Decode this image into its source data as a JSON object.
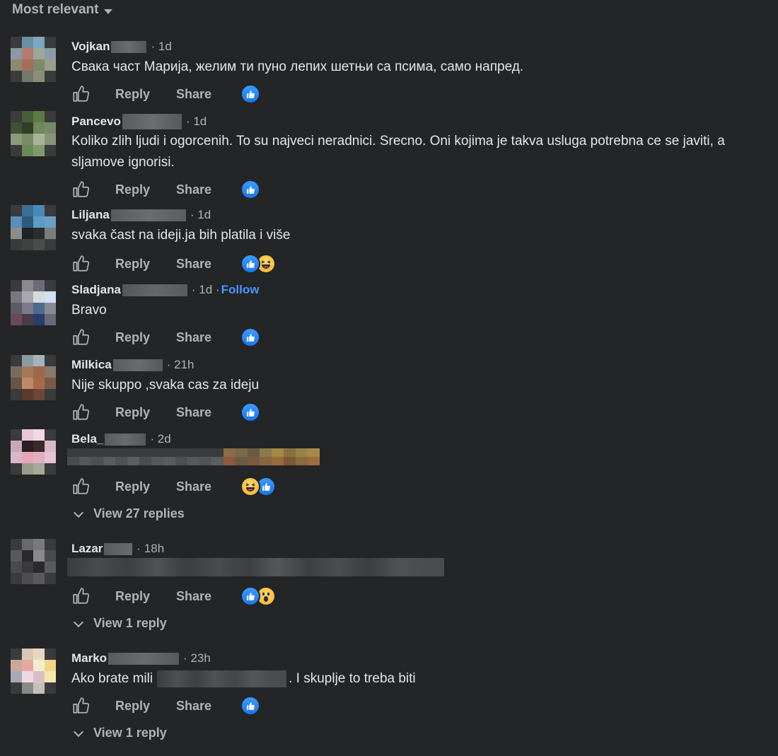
{
  "sort": {
    "label": "Most relevant"
  },
  "actions": {
    "reply": "Reply",
    "share": "Share"
  },
  "comments": [
    {
      "name": "Vojkan",
      "time": "· 1d",
      "text": "Свака част Марија, желим ти пуно лепих шетњи са псима, само напред.",
      "reactions": [
        "like"
      ],
      "replies": ""
    },
    {
      "name": "Pancevo",
      "time": "· 1d",
      "text": "Koliko zlih ljudi i ogorcenih. To su najveci neradnici. Srecno. Oni kojima je takva usluga potrebna ce se javiti, a sljamove ignorisi.",
      "reactions": [
        "like"
      ],
      "replies": ""
    },
    {
      "name": "Liljana",
      "time": "· 1d",
      "text": "svaka čast na ideji.ja bih platila i više",
      "reactions": [
        "like",
        "haha"
      ],
      "replies": ""
    },
    {
      "name": "Sladjana",
      "time": "· 1d ·",
      "follow": "Follow",
      "text": "Bravo",
      "reactions": [
        "like"
      ],
      "replies": ""
    },
    {
      "name": "Milkica",
      "time": "· 21h",
      "text": "Nije skuppo ,svaka cas za ideju",
      "reactions": [
        "like"
      ],
      "replies": ""
    },
    {
      "name": "Bela_",
      "time": "· 2d",
      "text": "",
      "reactions": [
        "haha",
        "like"
      ],
      "replies": "View 27 replies"
    },
    {
      "name": "Lazar",
      "time": "· 18h",
      "text": "",
      "reactions": [
        "like",
        "wow"
      ],
      "replies": "View 1 reply"
    },
    {
      "name": "Marko",
      "time": "· 23h",
      "text_before": "Ako brate mili",
      "text_after": ". I skuplje to treba biti",
      "reactions": [
        "like"
      ],
      "replies": "View 1 reply"
    }
  ]
}
